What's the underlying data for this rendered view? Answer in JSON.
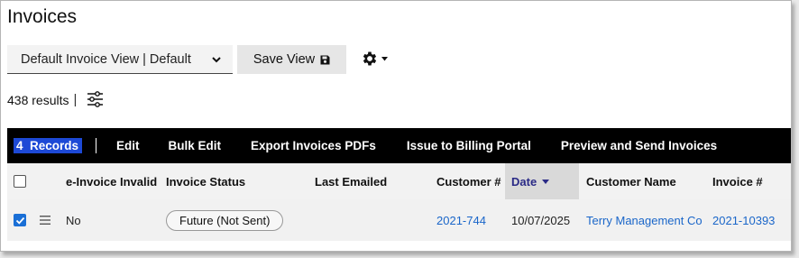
{
  "page": {
    "title": "Invoices"
  },
  "toolbar": {
    "view_select_value": "Default Invoice View | Default",
    "save_label": "Save View"
  },
  "results": {
    "count_text": "438 results",
    "separator": "|"
  },
  "action_bar": {
    "records_label": "4  Records",
    "separator": "|",
    "edit": "Edit",
    "bulk_edit": "Bulk Edit",
    "export_pdfs": "Export Invoices PDFs",
    "issue_portal": "Issue to Billing Portal",
    "preview_send": "Preview and Send Invoices"
  },
  "table": {
    "columns": {
      "einvoice_invalid": "e-Invoice Invalid",
      "invoice_status": "Invoice Status",
      "last_emailed": "Last Emailed",
      "customer_num": "Customer #",
      "date": "Date",
      "customer_name": "Customer Name",
      "invoice_num": "Invoice #"
    },
    "rows": [
      {
        "checked": true,
        "einvoice_invalid": "No",
        "invoice_status": "Future (Not Sent)",
        "last_emailed": "",
        "customer_num": "2021-744",
        "date": "10/07/2025",
        "customer_name": "Terry Management Co",
        "invoice_num": "2021-10393"
      }
    ]
  },
  "colors": {
    "accent_blue": "#1d49d6",
    "link_blue": "#1a66c9",
    "checkbox_blue": "#1a6fd6",
    "action_bar_bg": "#000000",
    "sorted_header_bg": "#d9d9d9"
  },
  "icons": [
    "chevron-down-icon",
    "floppy-disk-icon",
    "gear-icon",
    "caret-down-icon",
    "filter-sliders-icon",
    "checkmark-icon",
    "hamburger-icon",
    "sort-desc-icon"
  ]
}
